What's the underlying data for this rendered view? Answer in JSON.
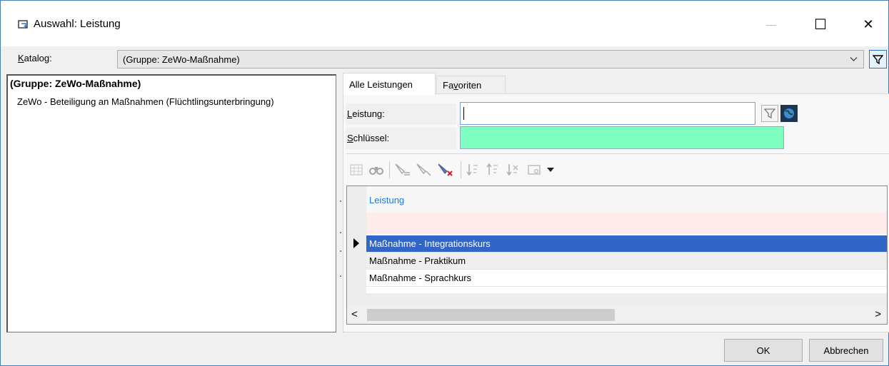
{
  "window": {
    "title": "Auswahl: Leistung",
    "minimize_symbol": "—",
    "maximize_symbol": "☐",
    "close_symbol": "✕"
  },
  "katalog": {
    "label_pre": "",
    "label_ul": "K",
    "label_post": "atalog:",
    "selected": "(Gruppe: ZeWo-Maßnahme)"
  },
  "tree": {
    "group": "(Gruppe: ZeWo-Maßnahme)",
    "items": [
      "ZeWo - Beteiligung an Maßnahmen (Flüchtlingsunterbringung)"
    ]
  },
  "tabs": {
    "all_pre": "Alle Leistun",
    "all_ul": "g",
    "all_post": "en",
    "fav_pre": "Fa",
    "fav_ul": "v",
    "fav_post": "oriten"
  },
  "form": {
    "leistung_ul": "L",
    "leistung_post": "eistung:",
    "leistung_value": "",
    "schluessel_ul": "S",
    "schluessel_post": "chlüssel:",
    "schluessel_value": ""
  },
  "grid": {
    "column_header": "Leistung",
    "rows": [
      "Maßnahme - Integrationskurs",
      "Maßnahme - Praktikum",
      "Maßnahme - Sprachkurs"
    ],
    "scroll_left": "<",
    "scroll_right": ">"
  },
  "buttons": {
    "ok": "OK",
    "cancel": "Abbrechen"
  },
  "colors": {
    "selection": "#3166c8",
    "schluessel_bg": "#7fffbf",
    "header_text": "#1c78d8"
  }
}
